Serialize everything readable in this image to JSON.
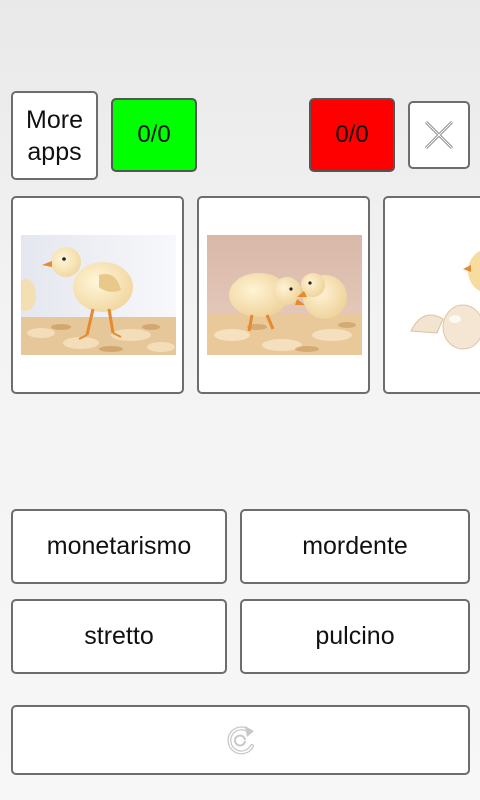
{
  "header": {
    "more_apps_line1": "More",
    "more_apps_line2": "apps",
    "correct_score": "0/0",
    "wrong_score": "0/0",
    "close_icon": "close-x-icon"
  },
  "colors": {
    "correct": "#00ff00",
    "wrong": "#ff0000"
  },
  "cards": [
    {
      "icon": "chick-photo"
    },
    {
      "icon": "two-chicks-photo"
    },
    {
      "icon": "eggs-chick-photo"
    }
  ],
  "answers": [
    "monetarismo",
    "mordente",
    "stretto",
    "pulcino"
  ],
  "footer": {
    "refresh_icon": "refresh-icon"
  }
}
